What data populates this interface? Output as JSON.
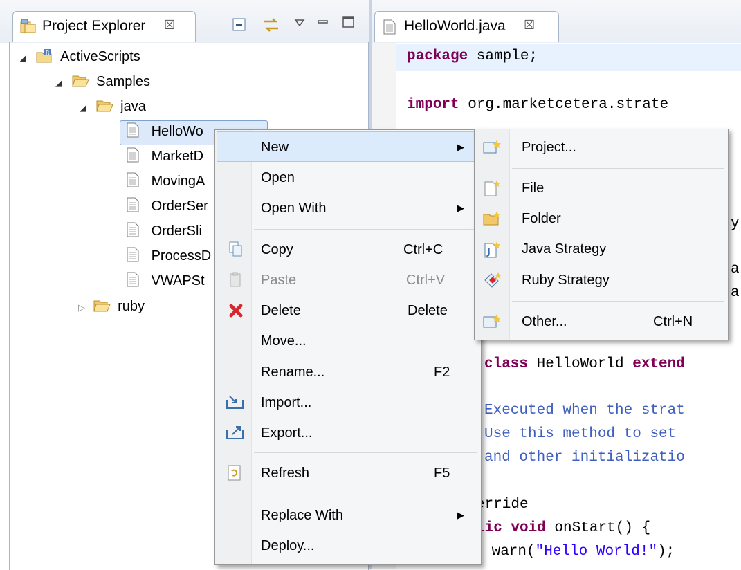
{
  "explorer": {
    "tab_title": "Project Explorer",
    "tab_close": "☒",
    "tree": [
      {
        "label": "ActiveScripts"
      },
      {
        "label": "Samples"
      },
      {
        "label": "java"
      },
      {
        "label": "HelloWo"
      },
      {
        "label": "MarketD"
      },
      {
        "label": "MovingA"
      },
      {
        "label": "OrderSer"
      },
      {
        "label": "OrderSli"
      },
      {
        "label": "ProcessD"
      },
      {
        "label": "VWAPSt"
      },
      {
        "label": "ruby"
      }
    ]
  },
  "editor": {
    "tab_title": "HelloWorld.java",
    "tab_close": "☒",
    "lines": {
      "l1_kw": "package",
      "l1_rest": " sample;",
      "l2_kw": "import",
      "l2_rest": " org.marketcetera.strate",
      "l3": "y",
      "l4": "a",
      "l5": "a",
      "l6_kw": "class",
      "l6_rest": " HelloWorld ",
      "l6_kw2": "extend",
      "c1": "Executed when the strat",
      "c2": "Use this method to set",
      "c3": "and other initializatio",
      "l7": "erride",
      "l8_kw": "lic void",
      "l8_rest": " onStart() {",
      "l9_pre": " warn(",
      "l9_str": "\"Hello World!\"",
      "l9_post": ");"
    }
  },
  "context_menu": {
    "items": [
      {
        "label": "New",
        "shortcut": "",
        "submenu": true
      },
      {
        "label": "Open",
        "shortcut": ""
      },
      {
        "label": "Open With",
        "shortcut": "",
        "submenu": true
      },
      {
        "label": "Copy",
        "shortcut": "Ctrl+C"
      },
      {
        "label": "Paste",
        "shortcut": "Ctrl+V",
        "disabled": true
      },
      {
        "label": "Delete",
        "shortcut": "Delete"
      },
      {
        "label": "Move...",
        "shortcut": ""
      },
      {
        "label": "Rename...",
        "shortcut": "F2"
      },
      {
        "label": "Import...",
        "shortcut": ""
      },
      {
        "label": "Export...",
        "shortcut": ""
      },
      {
        "label": "Refresh",
        "shortcut": "F5"
      },
      {
        "label": "Replace With",
        "shortcut": "",
        "submenu": true
      },
      {
        "label": "Deploy...",
        "shortcut": ""
      }
    ]
  },
  "new_submenu": {
    "items": [
      {
        "label": "Project...",
        "shortcut": ""
      },
      {
        "label": "File",
        "shortcut": ""
      },
      {
        "label": "Folder",
        "shortcut": ""
      },
      {
        "label": "Java Strategy",
        "shortcut": ""
      },
      {
        "label": "Ruby Strategy",
        "shortcut": ""
      },
      {
        "label": "Other...",
        "shortcut": "Ctrl+N"
      }
    ]
  },
  "colors": {
    "selection": "#dbe9fb",
    "keyword": "#7f0055",
    "comment": "#3f5fbf",
    "string": "#2a00ff",
    "delete_icon": "#d9262c"
  }
}
